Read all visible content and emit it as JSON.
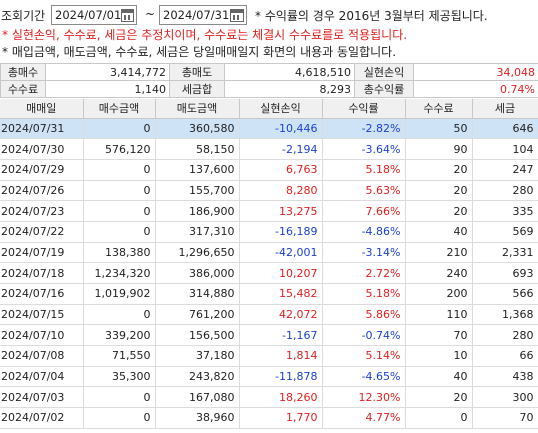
{
  "header": {
    "period_label": "조회기간",
    "start_date": "2024/07/01",
    "end_date": "2024/07/31",
    "tilde": "~",
    "note_rate": "* 수익률의 경우 2016년 3월부터 제공됩니다.",
    "note_estimate": "* 실현손익, 수수료, 세금은 추정치이며, 수수료는 체결시 수수료를로 적용됩니다.",
    "note_same": "* 매입금액, 매도금액, 수수료, 세금은 당일매매일지 화면의 내용과 동일합니다."
  },
  "summary": {
    "total_buy_label": "총매수",
    "total_buy": "3,414,772",
    "total_sell_label": "총매도",
    "total_sell": "4,618,510",
    "realized_label": "실현손익",
    "realized": "34,048",
    "fee_label": "수수료",
    "fee": "1,140",
    "tax_label": "세금합",
    "tax": "8,293",
    "rate_label": "총수익률",
    "rate": "0.74%"
  },
  "table": {
    "columns": [
      "매매일",
      "매수금액",
      "매도금액",
      "실현손익",
      "수익률",
      "수수료",
      "세금"
    ],
    "rows": [
      {
        "date": "2024/07/31",
        "buy": "0",
        "sell": "360,580",
        "pnl": "-10,446",
        "rate": "-2.82%",
        "fee": "50",
        "tax": "646",
        "sign": "neg",
        "selected": true
      },
      {
        "date": "2024/07/30",
        "buy": "576,120",
        "sell": "58,150",
        "pnl": "-2,194",
        "rate": "-3.64%",
        "fee": "90",
        "tax": "104",
        "sign": "neg"
      },
      {
        "date": "2024/07/29",
        "buy": "0",
        "sell": "137,600",
        "pnl": "6,763",
        "rate": "5.18%",
        "fee": "20",
        "tax": "247",
        "sign": "pos"
      },
      {
        "date": "2024/07/26",
        "buy": "0",
        "sell": "155,700",
        "pnl": "8,280",
        "rate": "5.63%",
        "fee": "20",
        "tax": "280",
        "sign": "pos"
      },
      {
        "date": "2024/07/23",
        "buy": "0",
        "sell": "186,900",
        "pnl": "13,275",
        "rate": "7.66%",
        "fee": "20",
        "tax": "335",
        "sign": "pos"
      },
      {
        "date": "2024/07/22",
        "buy": "0",
        "sell": "317,310",
        "pnl": "-16,189",
        "rate": "-4.86%",
        "fee": "40",
        "tax": "569",
        "sign": "neg"
      },
      {
        "date": "2024/07/19",
        "buy": "138,380",
        "sell": "1,296,650",
        "pnl": "-42,001",
        "rate": "-3.14%",
        "fee": "210",
        "tax": "2,331",
        "sign": "neg"
      },
      {
        "date": "2024/07/18",
        "buy": "1,234,320",
        "sell": "386,000",
        "pnl": "10,207",
        "rate": "2.72%",
        "fee": "240",
        "tax": "693",
        "sign": "pos"
      },
      {
        "date": "2024/07/16",
        "buy": "1,019,902",
        "sell": "314,880",
        "pnl": "15,482",
        "rate": "5.18%",
        "fee": "200",
        "tax": "566",
        "sign": "pos"
      },
      {
        "date": "2024/07/15",
        "buy": "0",
        "sell": "761,200",
        "pnl": "42,072",
        "rate": "5.86%",
        "fee": "110",
        "tax": "1,368",
        "sign": "pos"
      },
      {
        "date": "2024/07/10",
        "buy": "339,200",
        "sell": "156,500",
        "pnl": "-1,167",
        "rate": "-0.74%",
        "fee": "70",
        "tax": "280",
        "sign": "neg"
      },
      {
        "date": "2024/07/08",
        "buy": "71,550",
        "sell": "37,180",
        "pnl": "1,814",
        "rate": "5.14%",
        "fee": "10",
        "tax": "66",
        "sign": "pos"
      },
      {
        "date": "2024/07/04",
        "buy": "35,300",
        "sell": "243,820",
        "pnl": "-11,878",
        "rate": "-4.65%",
        "fee": "40",
        "tax": "438",
        "sign": "neg"
      },
      {
        "date": "2024/07/03",
        "buy": "0",
        "sell": "167,080",
        "pnl": "18,260",
        "rate": "12.30%",
        "fee": "20",
        "tax": "300",
        "sign": "pos"
      },
      {
        "date": "2024/07/02",
        "buy": "0",
        "sell": "38,960",
        "pnl": "1,770",
        "rate": "4.77%",
        "fee": "0",
        "tax": "70",
        "sign": "pos"
      }
    ]
  },
  "colors": {
    "positive": "#e02020",
    "negative": "#1a3fd0",
    "selected_row": "#cfe3f7",
    "header_bg": "#f0f0f0"
  }
}
